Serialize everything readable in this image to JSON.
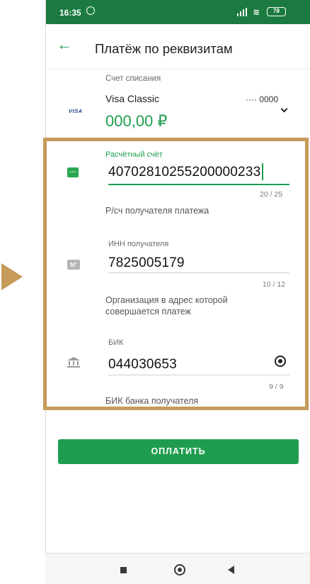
{
  "status_bar": {
    "time": "16:35",
    "battery": "78"
  },
  "header": {
    "title": "Платёж по реквизитам"
  },
  "debit_account": {
    "label": "Счет списания",
    "card_name": "Visa Classic",
    "card_logo": "VISA",
    "card_mask": "···· 0000",
    "balance": "000,00 ₽"
  },
  "fields": {
    "account": {
      "label": "Расчётный счёт",
      "value": "40702810255200000233",
      "counter": "20 / 25",
      "hint": "Р/сч получателя платежа"
    },
    "inn": {
      "icon_text": "N°",
      "label": "ИНН получателя",
      "value": "7825005179",
      "counter": "10 / 12",
      "hint_line1": "Организация в адрес которой",
      "hint_line2": "совершается платеж"
    },
    "bik": {
      "label": "БИК",
      "value": "044030653",
      "counter": "9 / 9",
      "hint": "БИК банка получателя"
    }
  },
  "pay_button": {
    "label": "ОПЛАТИТЬ"
  },
  "icons": {
    "back": "arrow-left-icon",
    "account": "dots-card-icon",
    "inn": "number-sign-icon",
    "bik": "bank-icon",
    "bik_action": "target-icon"
  },
  "colors": {
    "brand_green": "#1f9d4e",
    "status_bar": "#1a7a3f",
    "highlight": "#c59a5a"
  }
}
